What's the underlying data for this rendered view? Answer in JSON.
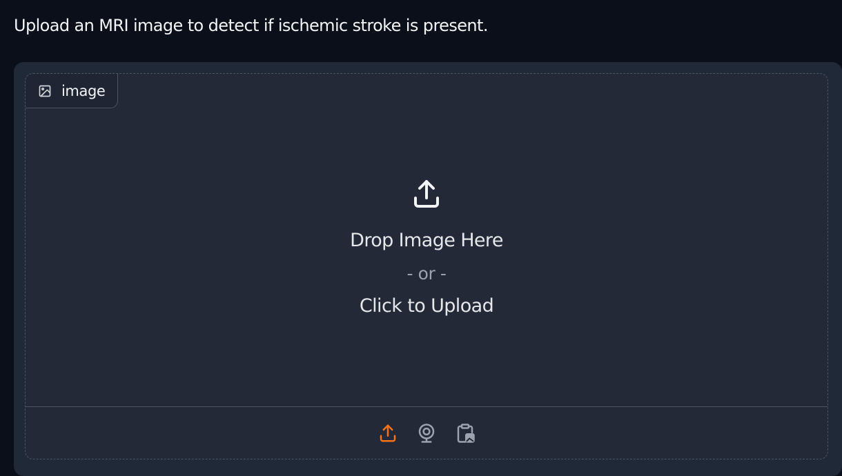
{
  "description": "Upload an MRI image to detect if ischemic stroke is present.",
  "image_input": {
    "label": "image",
    "label_icon": "image-icon",
    "drop_text": "Drop Image Here",
    "or_text": "- or -",
    "click_text": "Click to Upload",
    "sources": [
      {
        "name": "upload",
        "icon": "upload-icon",
        "active": true
      },
      {
        "name": "webcam",
        "icon": "webcam-icon",
        "active": false
      },
      {
        "name": "clipboard",
        "icon": "clipboard-icon",
        "active": false
      }
    ]
  },
  "colors": {
    "background": "#0b0f19",
    "panel": "#1f2937",
    "accent": "#f97316",
    "muted_icon": "#9ca3af"
  }
}
